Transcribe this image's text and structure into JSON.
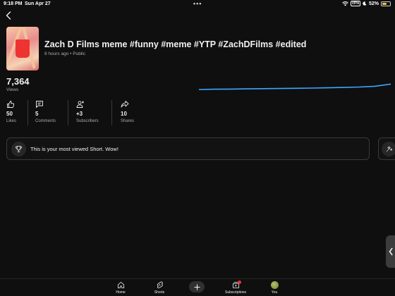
{
  "status_bar": {
    "time": "9:18 PM",
    "date": "Sun Apr 27",
    "dots": "•••",
    "vpn": "VPN",
    "battery_percent": "52%",
    "battery_level": 0.52
  },
  "short": {
    "title": "Zach D Films meme #funny #meme #YTP #ZachDFilms #edited",
    "age": "8 hours ago",
    "separator": "•",
    "visibility": "Public",
    "thumbnail_icon": "short-thumbnail"
  },
  "views": {
    "value": "7,364",
    "label": "Views"
  },
  "chart_data": {
    "type": "line",
    "series": [
      {
        "values": [
          0,
          5,
          8,
          12,
          15,
          18,
          22,
          26,
          31,
          38,
          46,
          60,
          100
        ]
      }
    ],
    "title": "",
    "xlabel": "",
    "ylabel": "",
    "grid": false,
    "color": "#3ea6ff"
  },
  "stats": [
    {
      "value": "50",
      "label": "Likes",
      "icon": "thumbs-up-icon"
    },
    {
      "value": "5",
      "label": "Comments",
      "icon": "comment-icon"
    },
    {
      "value": "+3",
      "label": "Subscribers",
      "icon": "add-person-icon"
    },
    {
      "value": "10",
      "label": "Shares",
      "icon": "share-icon"
    }
  ],
  "highlight": {
    "text": "This is your most viewed Short. Wow!",
    "icon": "trophy-icon"
  },
  "nav": {
    "home": "Home",
    "shorts": "Shorts",
    "create": "Create",
    "subscriptions": "Subscriptions",
    "you": "You"
  },
  "colors": {
    "background": "#0f0f0f",
    "accent_line": "#3ea6ff",
    "text_secondary": "#aaaaaa",
    "notification": "#ee3333"
  }
}
